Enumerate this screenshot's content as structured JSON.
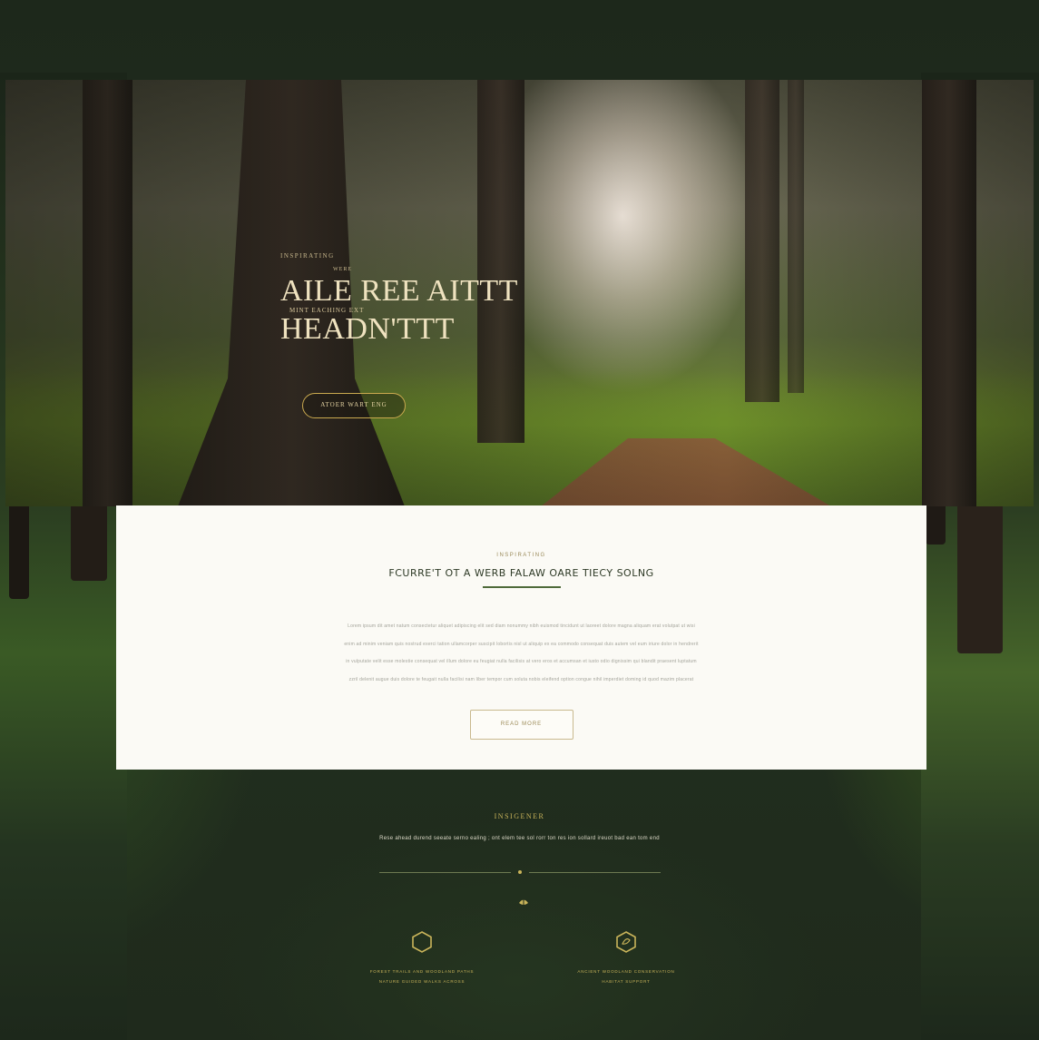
{
  "hero": {
    "eyebrow": "INSPIRATING",
    "kicker": "WERE",
    "title_line1": "AILE REE AITTT",
    "subtitle": "MINT EACHING   EXT",
    "title_line2": "HEADN'TTT",
    "button_label": "ATOER  WART  ENG"
  },
  "card": {
    "eyebrow": "INSPIRATING",
    "title": "FCURRE'T OT A WERB FALAW OARE TIECY SOLNG",
    "body_lines": [
      "Lorem ipsum dit amet natum consectetur aliquet adipiscing elit sed diam nonummy nibh euismod tincidunt ut laoreet dolore magna aliquam erat volutpat ut wisi",
      "enim ad minim veniam quis nostrud exerci tation ullamcorper suscipit lobortis nisl ut aliquip ex ea commodo consequat duis autem vel eum iriure dolor in hendrerit",
      "in vulputate velit esse molestie consequat vel illum dolore eu feugiat nulla facilisis at vero eros et accumsan et iusto odio dignissim qui blandit praesent luptatum",
      "zzril delenit augue duis dolore te feugait nulla facilisi nam liber tempor cum soluta nobis eleifend option congue nihil imperdiet doming id quod mazim placerat"
    ],
    "button_label": "READ MORE"
  },
  "footer": {
    "title": "INSIGENER",
    "text": "Rese ahead durend seeate serno ealing ; ont elem tee sol rorr ton res ion sollard ireuot bad ean tom end",
    "features": [
      {
        "icon": "hexagon-outline-icon",
        "lines": [
          "FOREST TRAILS AND WOODLAND PATHS",
          "NATURE GUIDED WALKS ACROSS"
        ]
      },
      {
        "icon": "shield-leaf-icon",
        "lines": [
          "ANCIENT WOODLAND CONSERVATION",
          "HABITAT SUPPORT"
        ]
      }
    ]
  },
  "colors": {
    "background": "#1e2a1c",
    "card": "#fbfaf5",
    "accent_gold": "#c9b45a",
    "title_cream": "#efe2bf"
  }
}
